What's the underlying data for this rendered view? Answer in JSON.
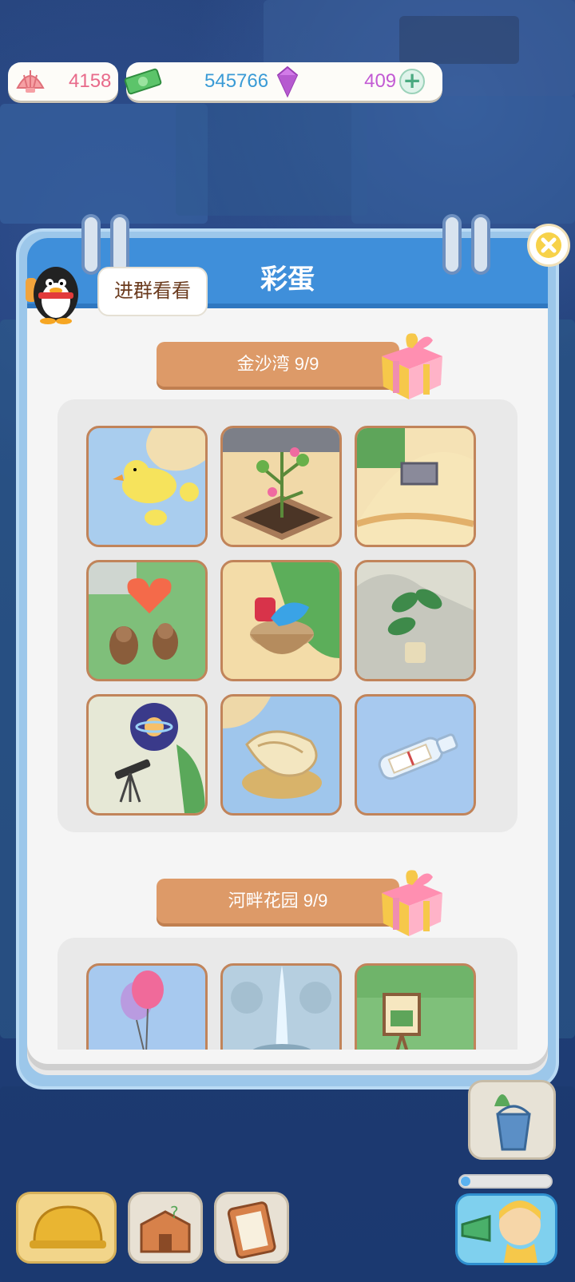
{
  "currency": {
    "shells": "4158",
    "cash": "545766",
    "gems": "409",
    "add_symbol": "+"
  },
  "panel": {
    "title": "彩蛋",
    "join_group_bubble": "进群看看"
  },
  "sections": [
    {
      "banner": "金沙湾  9/9",
      "tiles": [
        {
          "name": "rubber-duck-tile",
          "bg": "#a9cdee"
        },
        {
          "name": "heart-plant-tile",
          "bg": "#f1d9a8"
        },
        {
          "name": "tent-window-tile",
          "bg": "#f5e2b5"
        },
        {
          "name": "squirrels-heart-tile",
          "bg": "#7fbf7a"
        },
        {
          "name": "basket-tile",
          "bg": "#f3dca8"
        },
        {
          "name": "potted-plant-tile",
          "bg": "#dcdcd0"
        },
        {
          "name": "telescope-planet-tile",
          "bg": "#e6e8d6"
        },
        {
          "name": "conch-shell-tile",
          "bg": "#9fc6ec"
        },
        {
          "name": "message-bottle-tile",
          "bg": "#a7c9ef"
        }
      ]
    },
    {
      "banner": "河畔花园  9/9",
      "tiles": [
        {
          "name": "balloon-tile",
          "bg": "#a7c9ef"
        },
        {
          "name": "fountain-tile",
          "bg": "#b6cfe0"
        },
        {
          "name": "easel-tile",
          "bg": "#7fc07a"
        }
      ]
    }
  ],
  "colors": {
    "header_blue": "#3f8fda",
    "banner_orange": "#dd9a68",
    "shell_text": "#e86a8a",
    "cash_text": "#3a9bd6",
    "gem_text": "#c25ad4"
  }
}
